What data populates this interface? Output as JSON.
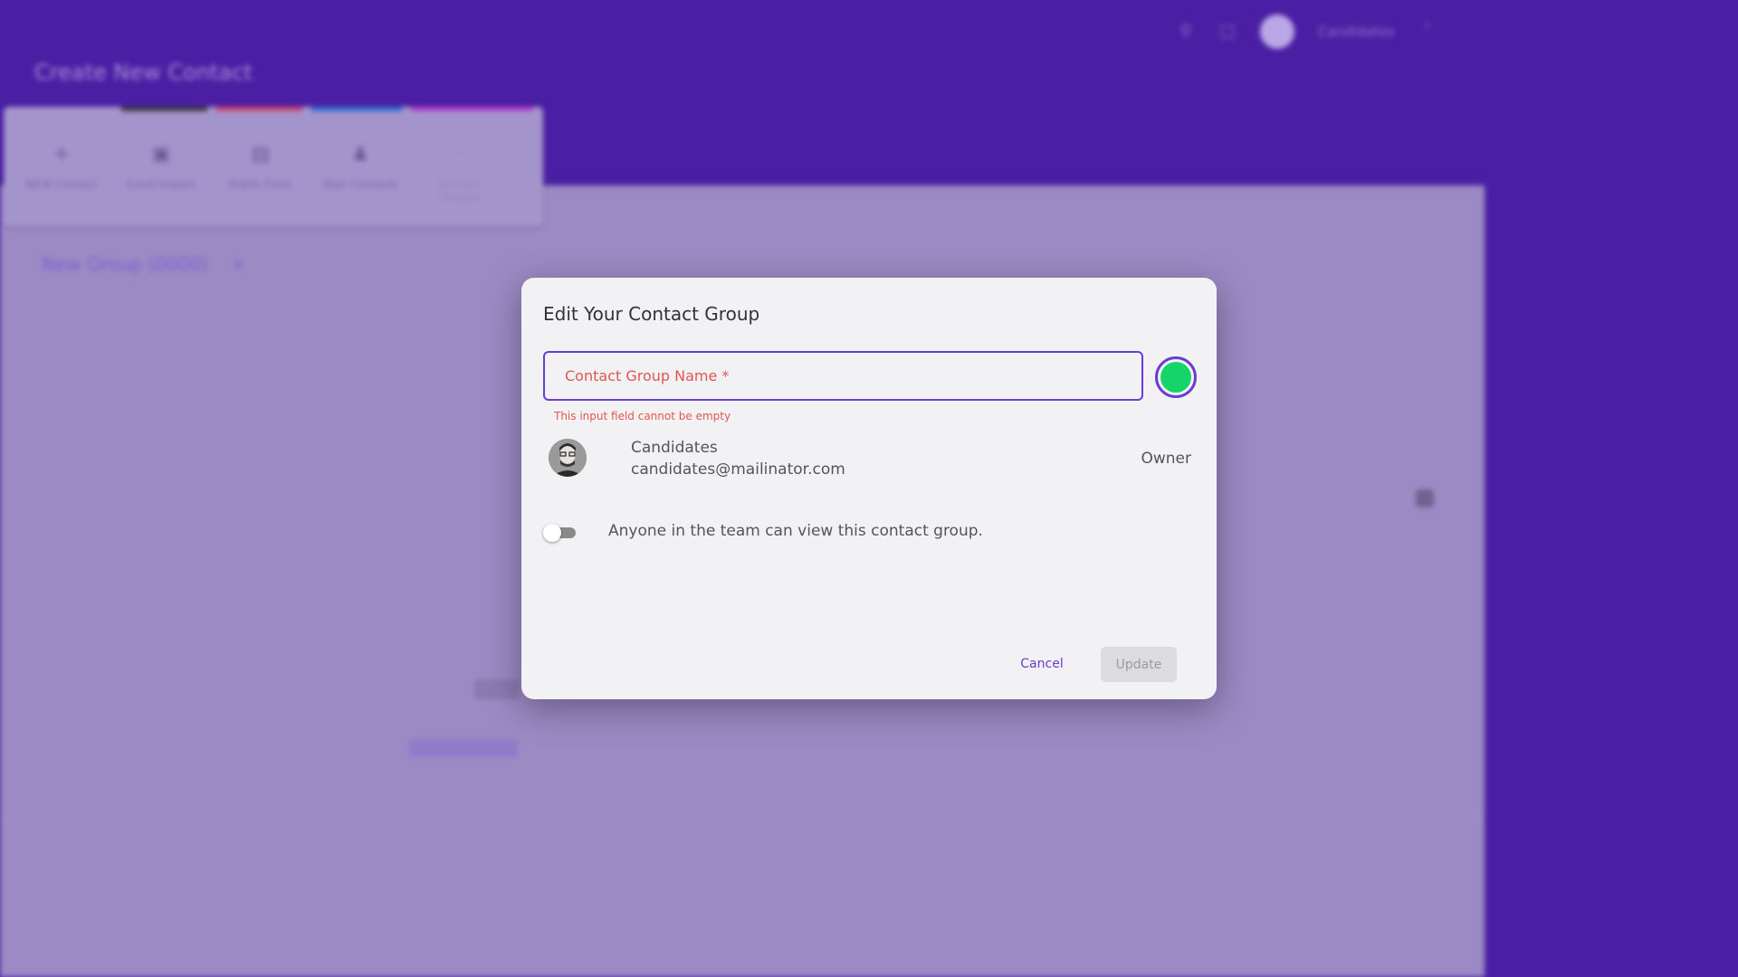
{
  "background": {
    "page_title": "Create New Contact",
    "header": {
      "user_name": "Candidates"
    },
    "toolbar": {
      "items": [
        "NEW Contact",
        "Excel Import",
        "Public Form",
        "Wait Contacts",
        "Contact Groups"
      ]
    },
    "group_tab": {
      "label": "New Group (0000)"
    }
  },
  "modal": {
    "title": "Edit Your Contact Group",
    "name_field": {
      "placeholder": "Contact Group Name *",
      "value": ""
    },
    "error": "This input field cannot be empty",
    "selected_color": "#15d46a",
    "member": {
      "name": "Candidates",
      "email": "candidates@mailinator.com",
      "role": "Owner"
    },
    "visibility_toggle": {
      "label": "Anyone in the team can view this contact group.",
      "on": false
    },
    "cancel_label": "Cancel",
    "update_label": "Update"
  }
}
